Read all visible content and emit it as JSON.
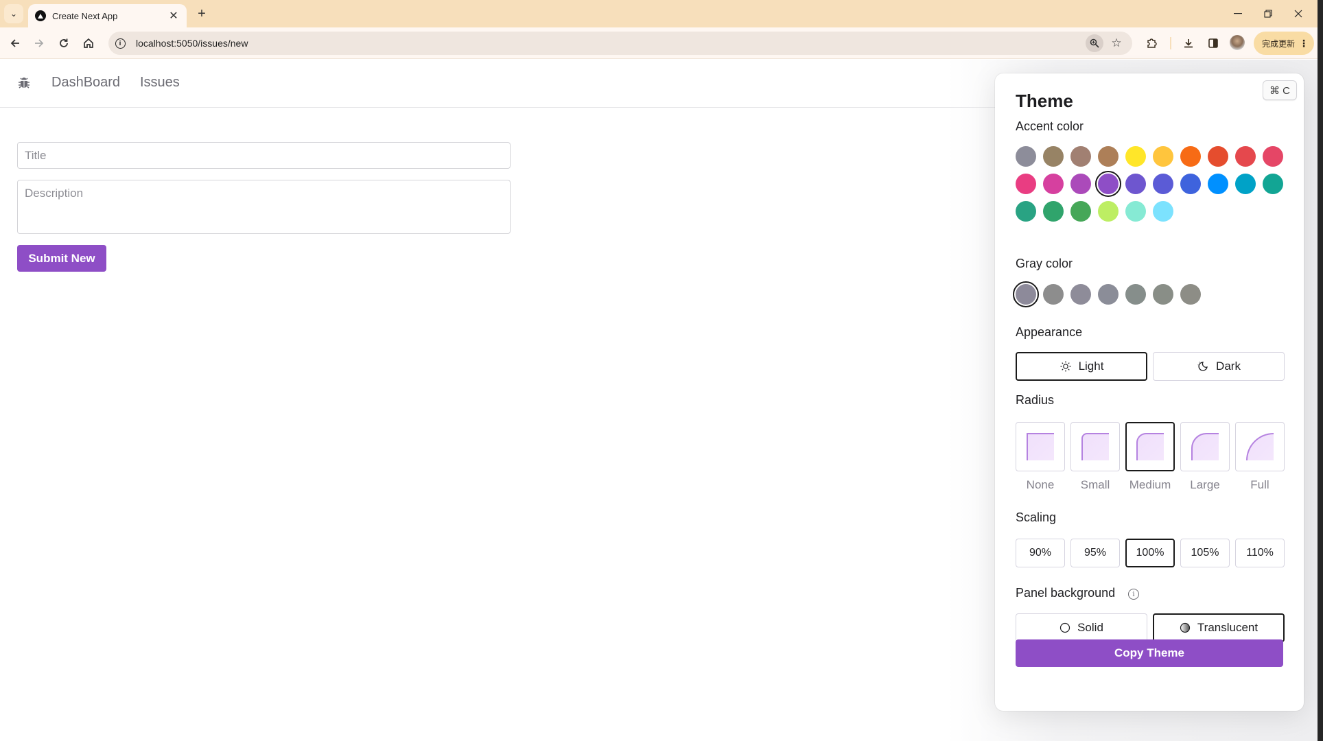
{
  "browser": {
    "tab_title": "Create Next App",
    "url": "localhost:5050/issues/new",
    "update_label": "完成更新",
    "icons": {
      "tab_list": "chevron-down-icon",
      "tab_close": "close-icon",
      "new_tab": "plus-icon",
      "minimize": "minimize-icon",
      "restore": "restore-icon",
      "close_window": "close-icon",
      "back": "arrow-left-icon",
      "forward": "arrow-right-icon",
      "reload": "reload-icon",
      "home": "home-icon",
      "site_info": "info-icon",
      "zoom": "zoom-icon",
      "bookmark": "star-icon",
      "extensions": "puzzle-icon",
      "downloads": "download-icon",
      "side_panel": "side-panel-icon",
      "profile": "avatar",
      "menu": "kebab-menu-icon"
    }
  },
  "nav": {
    "logo_icon": "bug-icon",
    "links": [
      {
        "label": "DashBoard"
      },
      {
        "label": "Issues"
      }
    ]
  },
  "form": {
    "title_placeholder": "Title",
    "title_value": "",
    "description_placeholder": "Description",
    "description_value": "",
    "submit_label": "Submit New",
    "accent_color": "#8e4ec6"
  },
  "theme_panel": {
    "title": "Theme",
    "shortcut_hint": "⌘ C",
    "accent": {
      "label": "Accent color",
      "selected": "violet",
      "swatches": [
        {
          "name": "gray",
          "color": "#8d8d9a"
        },
        {
          "name": "gold",
          "color": "#978365"
        },
        {
          "name": "bronze",
          "color": "#a18072"
        },
        {
          "name": "brown",
          "color": "#ad7f58"
        },
        {
          "name": "yellow",
          "color": "#ffe629"
        },
        {
          "name": "amber",
          "color": "#ffc53d"
        },
        {
          "name": "orange",
          "color": "#f76b15"
        },
        {
          "name": "tomato",
          "color": "#e54d2e"
        },
        {
          "name": "red",
          "color": "#e5484d"
        },
        {
          "name": "ruby",
          "color": "#e54666"
        },
        {
          "name": "crimson",
          "color": "#e93d82"
        },
        {
          "name": "pink",
          "color": "#d6409f"
        },
        {
          "name": "plum",
          "color": "#ab4aba"
        },
        {
          "name": "purple",
          "color": "#8e4ec6"
        },
        {
          "name": "violet",
          "color": "#6e56cf"
        },
        {
          "name": "iris",
          "color": "#5b5bd6"
        },
        {
          "name": "indigo",
          "color": "#3e63dd"
        },
        {
          "name": "blue",
          "color": "#0090ff"
        },
        {
          "name": "cyan",
          "color": "#00a2c7"
        },
        {
          "name": "teal",
          "color": "#12a594"
        },
        {
          "name": "jade",
          "color": "#29a383"
        },
        {
          "name": "green",
          "color": "#30a46c"
        },
        {
          "name": "grass",
          "color": "#46a758"
        },
        {
          "name": "lime",
          "color": "#bdee63"
        },
        {
          "name": "mint",
          "color": "#86ead4"
        },
        {
          "name": "sky",
          "color": "#7ce2fe"
        }
      ],
      "selected_index": 13
    },
    "gray": {
      "label": "Gray color",
      "selected_index": 0,
      "swatches": [
        {
          "name": "auto",
          "color": "#8d8a9a"
        },
        {
          "name": "gray",
          "color": "#8d8d8d"
        },
        {
          "name": "mauve",
          "color": "#8e8c99"
        },
        {
          "name": "slate",
          "color": "#8b8d98"
        },
        {
          "name": "sage",
          "color": "#868e8b"
        },
        {
          "name": "olive",
          "color": "#898e87"
        },
        {
          "name": "sand",
          "color": "#8d8d86"
        }
      ]
    },
    "appearance": {
      "label": "Appearance",
      "options": [
        {
          "label": "Light",
          "icon": "sun-icon",
          "selected": true
        },
        {
          "label": "Dark",
          "icon": "moon-icon",
          "selected": false
        }
      ]
    },
    "radius": {
      "label": "Radius",
      "options": [
        {
          "label": "None",
          "selected": false
        },
        {
          "label": "Small",
          "selected": false
        },
        {
          "label": "Medium",
          "selected": true
        },
        {
          "label": "Large",
          "selected": false
        },
        {
          "label": "Full",
          "selected": false
        }
      ]
    },
    "scaling": {
      "label": "Scaling",
      "options": [
        {
          "label": "90%",
          "selected": false
        },
        {
          "label": "95%",
          "selected": false
        },
        {
          "label": "100%",
          "selected": true
        },
        {
          "label": "105%",
          "selected": false
        },
        {
          "label": "110%",
          "selected": false
        }
      ]
    },
    "panel_background": {
      "label": "Panel background",
      "info_icon": "info-icon",
      "options": [
        {
          "label": "Solid",
          "icon": "circle-icon",
          "selected": false
        },
        {
          "label": "Translucent",
          "icon": "half-circle-icon",
          "selected": true
        }
      ]
    },
    "copy_label": "Copy Theme"
  }
}
